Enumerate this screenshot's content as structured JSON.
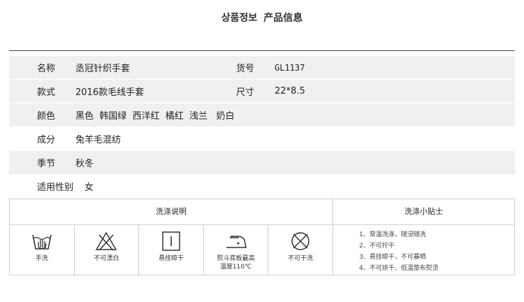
{
  "header": {
    "title_ko": "상품정보",
    "title_cn": "产品信息"
  },
  "spec": {
    "name_label": "名称",
    "name_value": "丞冠针织手套",
    "code_label": "货号",
    "code_value": "GL1137",
    "style_label": "款式",
    "style_value": "2016款毛线手套",
    "size_label": "尺寸",
    "size_value": "22*8.5",
    "color_label": "颜色",
    "color_value": "黑色  韩国绿  西洋红  橘红  浅兰   奶白",
    "material_label": "成分",
    "material_value": "兔羊毛混纺",
    "season_label": "季节",
    "season_value": "秋冬",
    "gender_label": "适用性别",
    "gender_value": "女"
  },
  "care": {
    "heading": "洗涤说明",
    "icons": [
      {
        "icon": "hand-wash-icon",
        "label": "手洗"
      },
      {
        "icon": "no-bleach-icon",
        "label": "不可漂白"
      },
      {
        "icon": "hang-dry-icon",
        "label": "悬挂晾干"
      },
      {
        "icon": "iron-icon",
        "label": "熨斗底板最高\n温度110℃"
      },
      {
        "icon": "no-dry-clean-icon",
        "label": "不可干洗"
      }
    ],
    "tips_heading": "洗涤小贴士",
    "tips": [
      "1、常温洗涤，随浸随洗",
      "2、不可拧干",
      "3、悬挂晾干，不可暴晒",
      "4、不可烘干、低温垫布熨烫"
    ]
  }
}
